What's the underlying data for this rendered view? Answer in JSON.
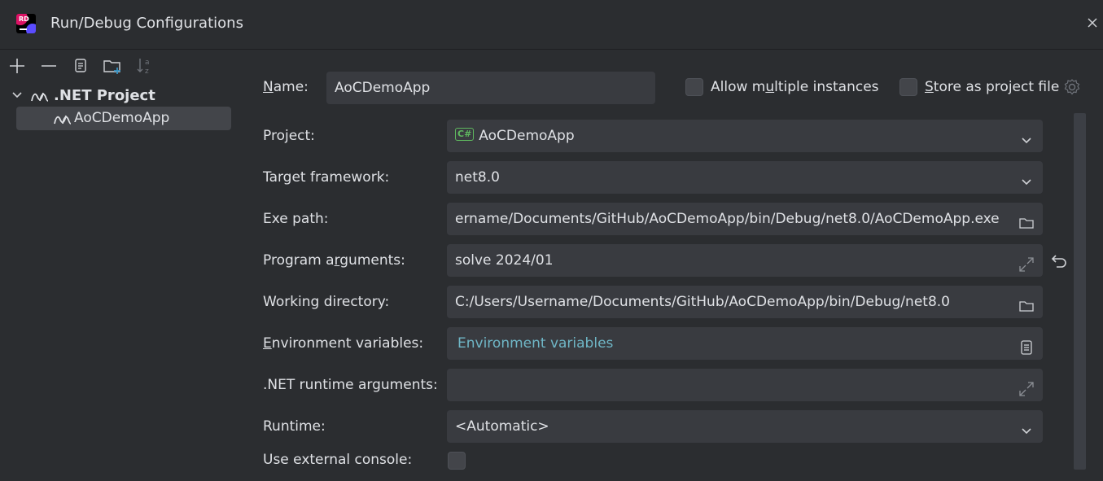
{
  "window": {
    "title": "Run/Debug Configurations",
    "app_icon_text": "RD"
  },
  "toolbar": {
    "icons": [
      "add-icon",
      "remove-icon",
      "copy-icon",
      "new-folder-icon",
      "sort-az-icon"
    ],
    "sort_label": "a\nz"
  },
  "tree": {
    "parent_label": ".NET Project",
    "child_label": "AoCDemoApp"
  },
  "form": {
    "name_label_prefix": "N",
    "name_label_rest": "ame:",
    "name_value": "AoCDemoApp",
    "allow_multiple_label_pre": "Allow m",
    "allow_multiple_label_u": "u",
    "allow_multiple_label_post": "ltiple instances",
    "store_label_u": "S",
    "store_label_rest": "tore as project file",
    "project_label": "Project:",
    "project_badge": "C#",
    "project_value": "AoCDemoApp",
    "target_framework_label": "Target framework:",
    "target_framework_value": "net8.0",
    "exe_path_label": "Exe path:",
    "exe_path_value": "ername/Documents/GitHub/AoCDemoApp/bin/Debug/net8.0/AoCDemoApp.exe",
    "program_args_label_pre": "Program a",
    "program_args_label_u": "r",
    "program_args_label_post": "guments:",
    "program_args_value": "solve 2024/01",
    "working_dir_label": "Working directory:",
    "working_dir_value": "C:/Users/Username/Documents/GitHub/AoCDemoApp/bin/Debug/net8.0",
    "env_label_u": "E",
    "env_label_rest": "nvironment variables:",
    "env_value": "Environment variables",
    "runtime_args_label": ".NET runtime arguments:",
    "runtime_args_value": "",
    "runtime_label": "Runtime:",
    "runtime_value": "<Automatic>",
    "external_console_label": "Use external console:"
  },
  "colors": {
    "background": "#2b2d30",
    "field": "#393b40",
    "selection": "#43454a",
    "link": "#6fb6c6",
    "csharp_badge": "#5fb85f"
  }
}
